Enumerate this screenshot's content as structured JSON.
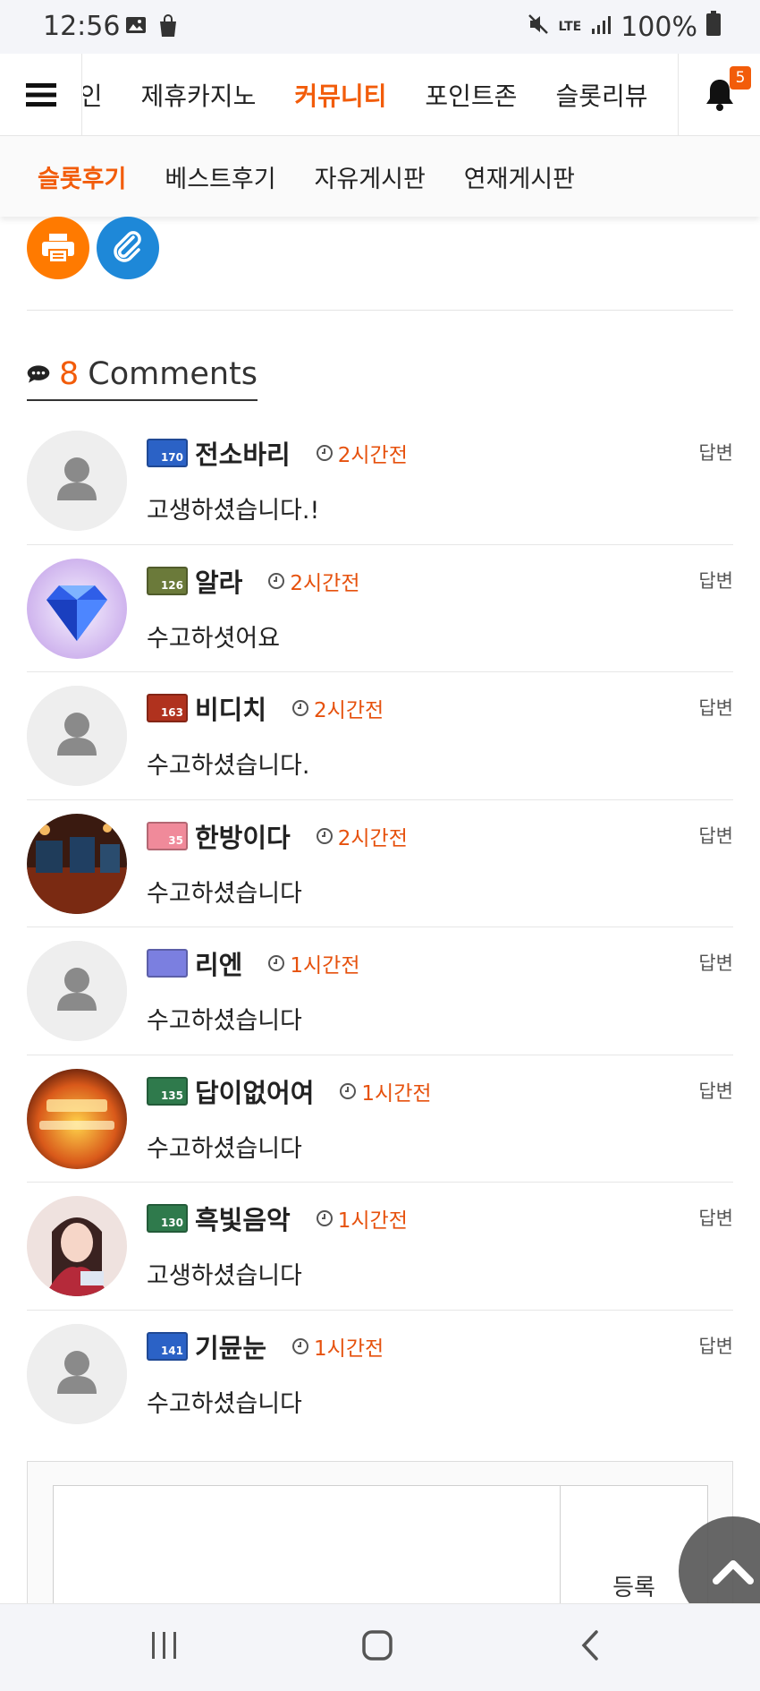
{
  "status_bar": {
    "time": "12:56",
    "battery": "100%",
    "network": "LTE"
  },
  "top_nav": {
    "items": [
      "메인",
      "제휴카지노",
      "커뮤니티",
      "포인트존",
      "슬롯리뷰"
    ],
    "active": "커뮤니티",
    "notification_count": "5"
  },
  "sub_nav": {
    "items": [
      "슬롯후기",
      "베스트후기",
      "자유게시판",
      "연재게시판"
    ],
    "active": "슬롯후기"
  },
  "comments": {
    "count": "8",
    "label": "Comments",
    "reply_label": "답변",
    "items": [
      {
        "nick": "전소바리",
        "level": "170",
        "time": "2시간전",
        "text": "고생하셨습니다.!",
        "avatar": "default",
        "lvl_color": "#2b62c6"
      },
      {
        "nick": "알라",
        "level": "126",
        "time": "2시간전",
        "text": "수고하셧어요",
        "avatar": "diamond",
        "lvl_color": "#6b7a3a"
      },
      {
        "nick": "비디치",
        "level": "163",
        "time": "2시간전",
        "text": "수고하셨습니다.",
        "avatar": "default",
        "lvl_color": "#b0321e"
      },
      {
        "nick": "한방이다",
        "level": "35",
        "time": "2시간전",
        "text": "수고하셨습니다",
        "avatar": "casino",
        "lvl_color": "#f08a9a"
      },
      {
        "nick": "리엔",
        "level": "",
        "time": "1시간전",
        "text": "수고하셨습니다",
        "avatar": "default",
        "lvl_color": "#7b7fe0"
      },
      {
        "nick": "답이없어여",
        "level": "135",
        "time": "1시간전",
        "text": "수고하셨습니다",
        "avatar": "jackpot",
        "lvl_color": "#2f7a4c"
      },
      {
        "nick": "흑빛음악",
        "level": "130",
        "time": "1시간전",
        "text": "고생하셨습니다",
        "avatar": "anime",
        "lvl_color": "#2f7a4c"
      },
      {
        "nick": "기뮨눈",
        "level": "141",
        "time": "1시간전",
        "text": "수고하셨습니다",
        "avatar": "default",
        "lvl_color": "#2b62c6"
      }
    ]
  },
  "write": {
    "submit_label": "등록",
    "placeholder": ""
  },
  "colors": {
    "accent": "#f25c0a",
    "print_button": "#ff7a00",
    "link_button": "#1e88d8"
  },
  "icons": [
    "menu-icon",
    "bell-icon",
    "print-icon",
    "link-icon",
    "comment-icon",
    "clock-icon",
    "user-icon",
    "chevron-up-icon"
  ]
}
